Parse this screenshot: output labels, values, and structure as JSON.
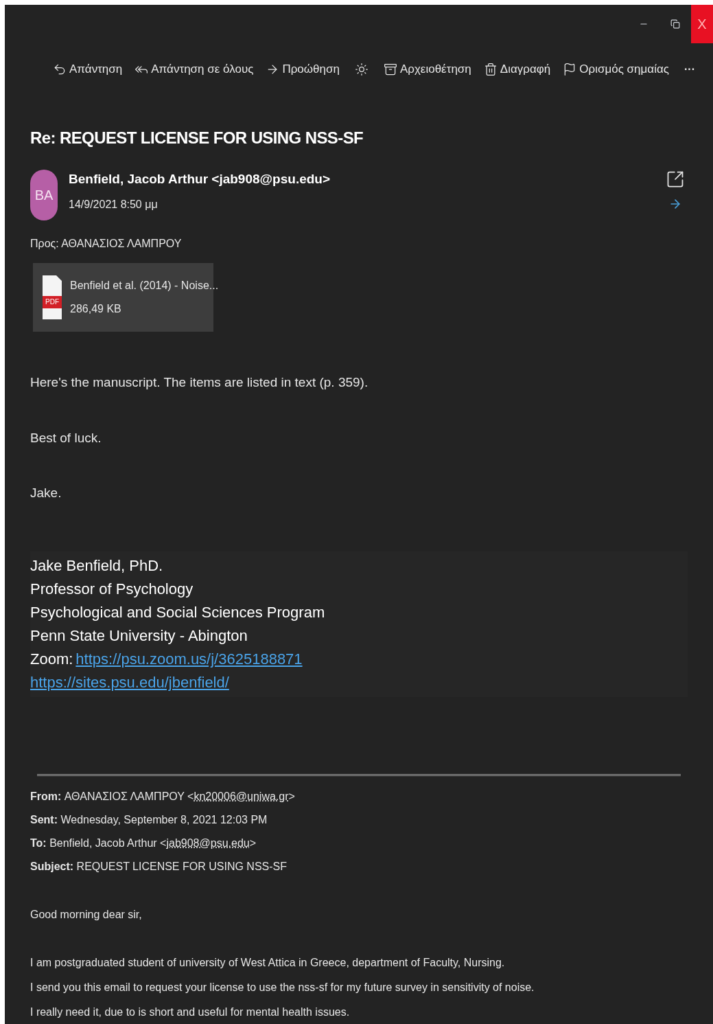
{
  "window_controls": [
    {
      "kind": "minimize"
    },
    {
      "kind": "restore"
    },
    {
      "kind": "close",
      "label": "X"
    }
  ],
  "toolbar": [
    {
      "kind": "reply",
      "label": "Απάντηση"
    },
    {
      "kind": "reply_all",
      "label": "Απάντηση σε όλους"
    },
    {
      "kind": "forward",
      "label": "Προώθηση"
    },
    {
      "kind": "sun"
    },
    {
      "kind": "archive",
      "label": "Αρχειοθέτηση"
    },
    {
      "kind": "delete",
      "label": "Διαγραφή"
    },
    {
      "kind": "flag",
      "label": "Ορισμός σημαίας"
    },
    {
      "kind": "more",
      "label": "···"
    }
  ],
  "subject": "Re: REQUEST LICENSE FOR USING NSS-SF",
  "sender": {
    "initials": "BA",
    "color": "#b65fa6",
    "name": "Benfield, Jacob Arthur <jab908@psu.edu>",
    "date": "14/9/2021 8:50 μμ"
  },
  "to": "Προς: ΑΘΑΝΑΣΙΟΣ ΛΑΜΠΡΟΥ",
  "attachment": {
    "badge": "PDF",
    "name": "Benfield et al. (2014) - Noise...",
    "size": "286,49 KB"
  },
  "body": [
    "Here's the manuscript. The items are listed in text (p. 359).",
    "Best of luck.",
    "Jake."
  ],
  "signature": [
    {
      "text": "Jake Benfield, PhD."
    },
    {
      "text": "Professor of Psychology"
    },
    {
      "text": "Psychological and Social Sciences Program"
    },
    {
      "text": "Penn State University - Abington"
    },
    {
      "text": "Zoom: ",
      "link": "https://psu.zoom.us/j/3625188871"
    },
    {
      "link": "https://sites.psu.edu/jbenfield/"
    }
  ],
  "quoted_header": [
    {
      "label": "From:",
      "text": " ΑΘΑΝΑΣΙΟΣ ΛΑΜΠΡΟΥ <",
      "email": "kn20006@uniwa.gr",
      "after": ">"
    },
    {
      "label": "Sent:",
      "text": " Wednesday, September 8, 2021 12:03 PM"
    },
    {
      "label": "To:",
      "text": " Benfield, Jacob Arthur <",
      "email": "jab908@psu.edu",
      "after": ">"
    },
    {
      "label": "Subject:",
      "text": " REQUEST LICENSE FOR USING NSS-SF"
    }
  ],
  "greeting": "Good morning dear sir,",
  "quoted_body": [
    "I am postgraduated student of university of West Attica in Greece, department of Faculty, Nursing.",
    "I send you this email to request your license to use the nss-sf for my future survey in sensitivity of noise.",
    "I really need it, due to is short and useful for mental health issues."
  ]
}
